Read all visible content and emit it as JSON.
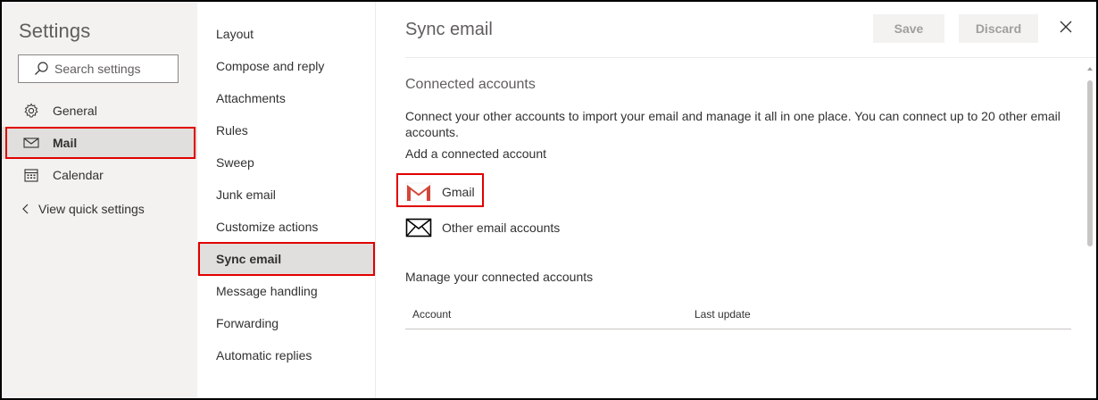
{
  "settings": {
    "title": "Settings",
    "search_placeholder": "Search settings"
  },
  "nav": {
    "items": [
      {
        "label": "General",
        "icon": "gear-icon"
      },
      {
        "label": "Mail",
        "icon": "mail-icon",
        "selected": true
      },
      {
        "label": "Calendar",
        "icon": "calendar-icon"
      }
    ],
    "view_quick_settings": "View quick settings"
  },
  "mail_menu": {
    "items": [
      "Layout",
      "Compose and reply",
      "Attachments",
      "Rules",
      "Sweep",
      "Junk email",
      "Customize actions",
      "Sync email",
      "Message handling",
      "Forwarding",
      "Automatic replies"
    ],
    "selected": "Sync email"
  },
  "panel": {
    "title": "Sync email",
    "save_label": "Save",
    "discard_label": "Discard",
    "section_title": "Connected accounts",
    "description": "Connect your other accounts to import your email and manage it all in one place. You can connect up to 20 other email accounts.",
    "add_label": "Add a connected account",
    "gmail_label": "Gmail",
    "other_label": "Other email accounts",
    "manage_label": "Manage your connected accounts",
    "table_columns": [
      "Account",
      "Last update"
    ]
  },
  "colors": {
    "highlight": "#e00000",
    "selected_bg": "#e1dfdd",
    "gmail_red": "#d44638"
  }
}
